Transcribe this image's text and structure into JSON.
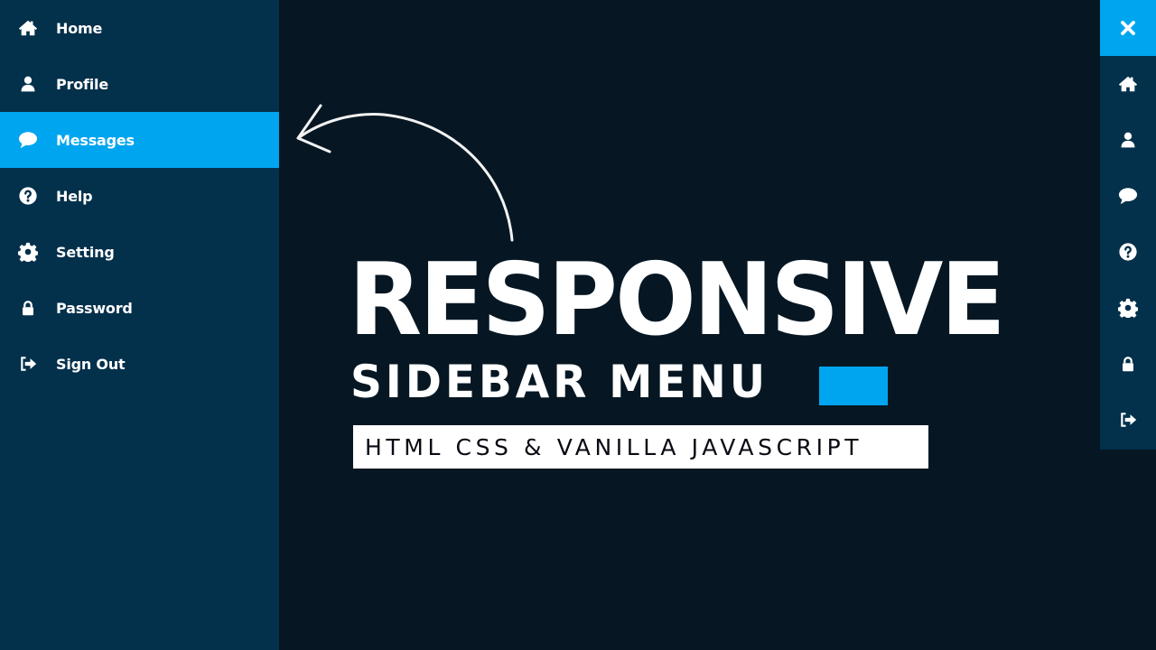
{
  "sidebar": {
    "items": [
      {
        "label": "Home",
        "icon": "home-icon",
        "active": false
      },
      {
        "label": "Profile",
        "icon": "user-icon",
        "active": false
      },
      {
        "label": "Messages",
        "icon": "comment-icon",
        "active": true
      },
      {
        "label": "Help",
        "icon": "question-circle-icon",
        "active": false
      },
      {
        "label": "Setting",
        "icon": "gear-icon",
        "active": false
      },
      {
        "label": "Password",
        "icon": "lock-icon",
        "active": false
      },
      {
        "label": "Sign Out",
        "icon": "sign-out-icon",
        "active": false
      }
    ]
  },
  "collapsed_bar": {
    "close_icon": "close-icon",
    "icons": [
      "home-icon",
      "user-icon",
      "comment-icon",
      "question-circle-icon",
      "gear-icon",
      "lock-icon",
      "sign-out-icon"
    ]
  },
  "hero": {
    "title": "RESPONSIVE",
    "subtitle": "SIDEBAR MENU",
    "tagline": "HTML CSS & VANILLA JAVASCRIPT"
  },
  "colors": {
    "accent": "#00a5ef",
    "sidebar_bg": "#03304b",
    "page_bg": "#061723"
  }
}
